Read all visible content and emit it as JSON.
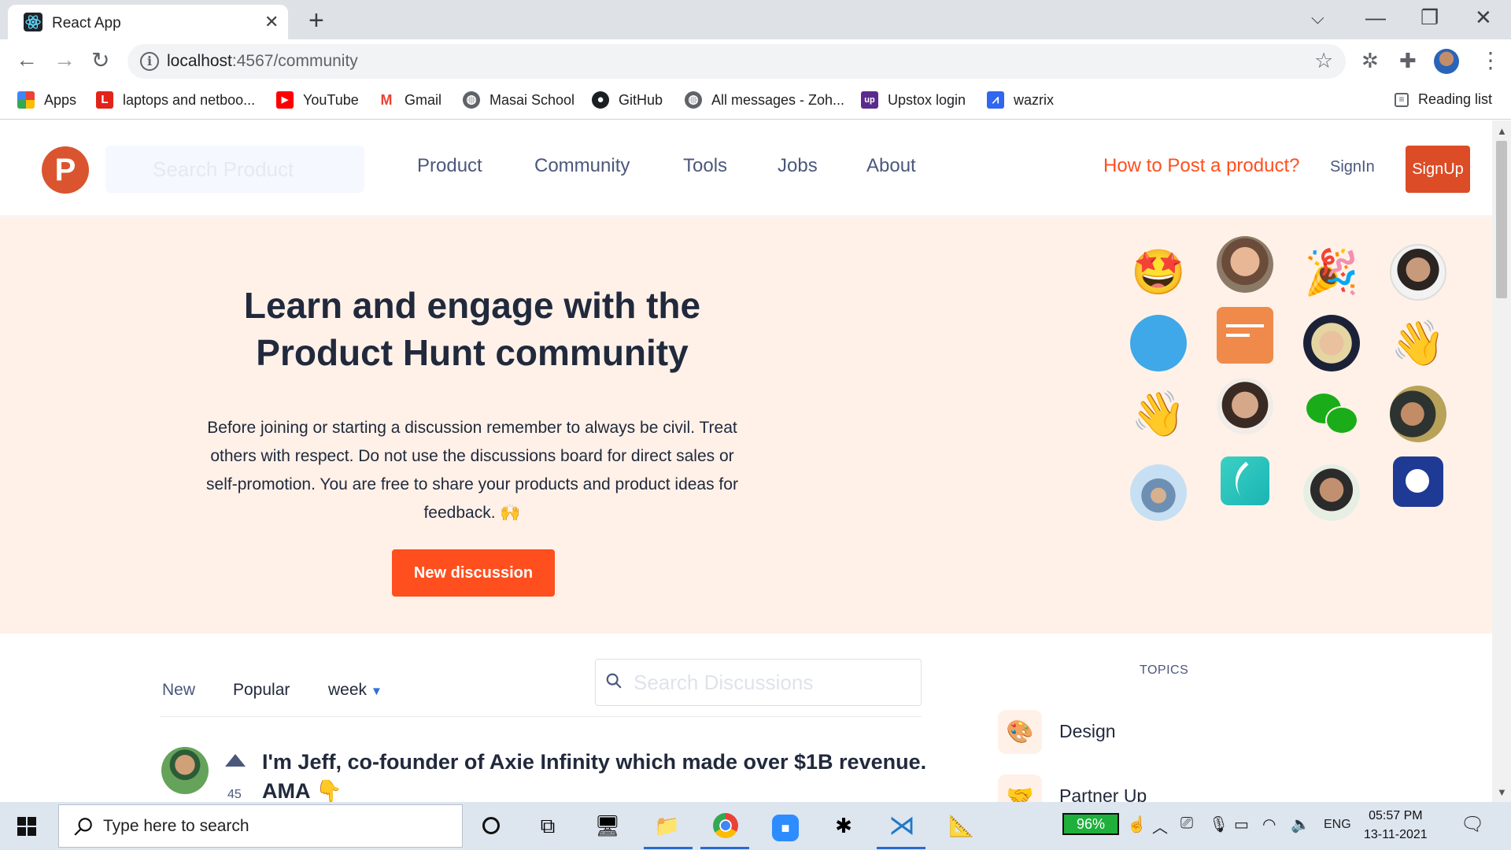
{
  "browser": {
    "tab_title": "React App",
    "url_host": "localhost",
    "url_rest": ":4567/community",
    "bookmarks": [
      {
        "label": "Apps",
        "icon": "apps-grid-icon"
      },
      {
        "label": "laptops and netboo...",
        "icon": "lenovo-icon"
      },
      {
        "label": "YouTube",
        "icon": "youtube-icon"
      },
      {
        "label": "Gmail",
        "icon": "gmail-icon"
      },
      {
        "label": "Masai School",
        "icon": "globe-icon"
      },
      {
        "label": "GitHub",
        "icon": "github-icon"
      },
      {
        "label": "All messages - Zoh...",
        "icon": "globe-icon"
      },
      {
        "label": "Upstox login",
        "icon": "upstox-icon"
      },
      {
        "label": "wazrix",
        "icon": "wazirx-icon"
      }
    ],
    "reading_list": "Reading list"
  },
  "site": {
    "logo_letter": "P",
    "search_placeholder": "Search Product",
    "nav": [
      "Product",
      "Community",
      "Tools",
      "Jobs",
      "About"
    ],
    "how_to_post": "How to Post a product?",
    "signin": "SignIn",
    "signup": "SignUp"
  },
  "hero": {
    "title": "Learn and engage with the Product Hunt community",
    "text": "Before joining or starting a discussion remember to always be civil. Treat others with respect. Do not use the discussions board for direct sales or self-promotion. You are free to share your products and product ideas for feedback. 🙌",
    "button": "New discussion"
  },
  "feed": {
    "tabs": [
      "New",
      "Popular"
    ],
    "period": "week",
    "search_placeholder": "Search Discussions",
    "posts": [
      {
        "title": "I'm Jeff, co-founder of Axie Infinity which made over $1B revenue. AMA 👇",
        "votes": "45"
      }
    ]
  },
  "topics": {
    "heading": "TOPICS",
    "items": [
      {
        "label": "Design",
        "icon": "palette-icon"
      },
      {
        "label": "Partner Up",
        "icon": "handshake-icon"
      }
    ]
  },
  "taskbar": {
    "search_placeholder": "Type here to search",
    "battery": "96%",
    "language": "ENG",
    "time": "05:57 PM",
    "date": "13-11-2021"
  },
  "colors": {
    "brand": "#da552f",
    "accent": "#ff4f1e",
    "hero_bg": "#fff1e8",
    "text_dark": "#21293c",
    "text_muted": "#4b587c"
  }
}
